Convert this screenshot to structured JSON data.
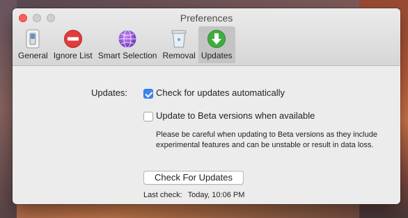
{
  "window": {
    "title": "Preferences"
  },
  "toolbar": {
    "items": [
      {
        "label": "General",
        "icon": "switch-icon"
      },
      {
        "label": "Ignore List",
        "icon": "no-entry-icon"
      },
      {
        "label": "Smart Selection",
        "icon": "globe-icon"
      },
      {
        "label": "Removal",
        "icon": "trash-icon"
      },
      {
        "label": "Updates",
        "icon": "download-arrow-icon",
        "active": true
      }
    ]
  },
  "updates": {
    "section_label": "Updates:",
    "auto_check": {
      "label": "Check for updates automatically",
      "checked": true
    },
    "beta": {
      "label": "Update to Beta versions when available",
      "checked": false
    },
    "beta_note": "Please be careful when updating to Beta versions as they include experimental features and can be unstable or result in data loss.",
    "check_button": "Check For Updates",
    "last_check_label": "Last check:",
    "last_check_value": "Today, 10:06 PM"
  },
  "colors": {
    "accent": "#3b86f1",
    "close": "#fc5f57"
  }
}
